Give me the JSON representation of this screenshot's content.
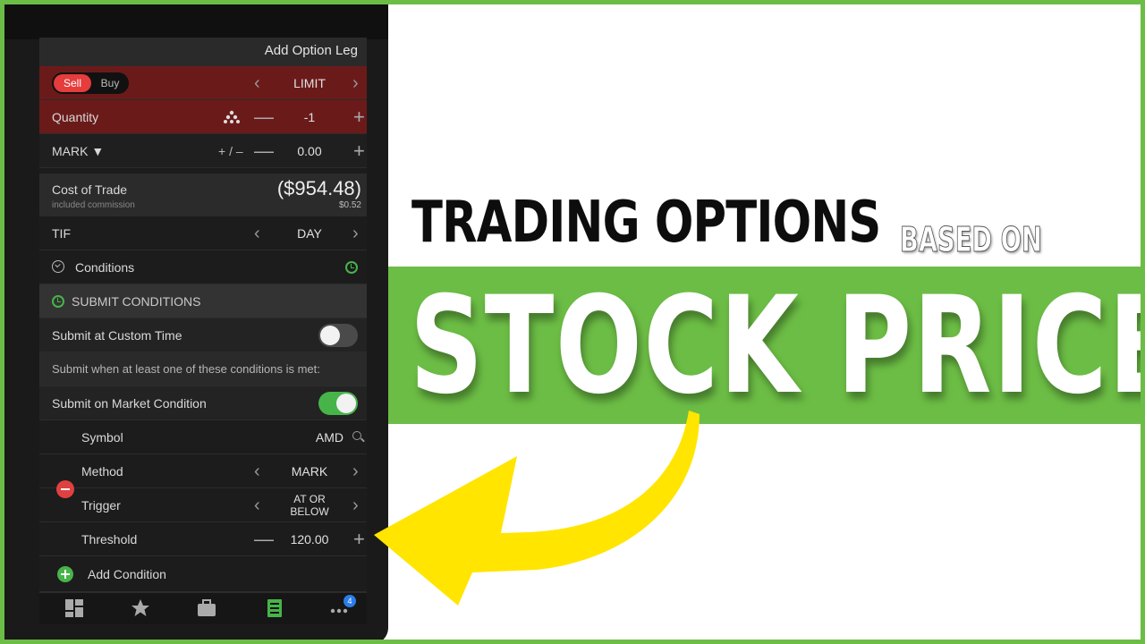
{
  "headline": {
    "line1": "TRADING OPTIONS",
    "line1_suffix": "BASED ON",
    "line2": "STOCK PRICE"
  },
  "colors": {
    "accent_green": "#6cbd45",
    "sell_red": "#e63c3c",
    "arrow_yellow": "#ffe500",
    "toggle_green": "#47b449"
  },
  "app": {
    "header_title": "Add Option Leg",
    "side": {
      "sell": "Sell",
      "buy": "Buy",
      "selected": "Sell"
    },
    "order_type": "LIMIT",
    "quantity": {
      "label": "Quantity",
      "value": "-1",
      "icon": "split-icon"
    },
    "price": {
      "label": "MARK ▼",
      "adjust": "+ / –",
      "value": "0.00"
    },
    "cost": {
      "label": "Cost of Trade",
      "note": "included commission",
      "amount": "($954.48)",
      "commission": "$0.52"
    },
    "tif": {
      "label": "TIF",
      "value": "DAY"
    },
    "conditions": {
      "label": "Conditions",
      "section": "SUBMIT CONDITIONS"
    },
    "custom_time": {
      "label": "Submit at Custom Time",
      "on": false
    },
    "info": "Submit when at least one of these conditions is met:",
    "market_condition": {
      "label": "Submit on Market Condition",
      "on": true
    },
    "symbol": {
      "label": "Symbol",
      "value": "AMD"
    },
    "method": {
      "label": "Method",
      "value": "MARK"
    },
    "trigger": {
      "label": "Trigger",
      "value_line1": "AT OR",
      "value_line2": "BELOW"
    },
    "threshold": {
      "label": "Threshold",
      "value": "120.00"
    },
    "add_condition": "Add Condition",
    "tabs": [
      {
        "icon": "grid-icon"
      },
      {
        "icon": "watchlist-star-icon"
      },
      {
        "icon": "briefcase-icon"
      },
      {
        "icon": "order-ticket-icon"
      },
      {
        "icon": "more-dots-icon",
        "badge": "4"
      }
    ]
  }
}
